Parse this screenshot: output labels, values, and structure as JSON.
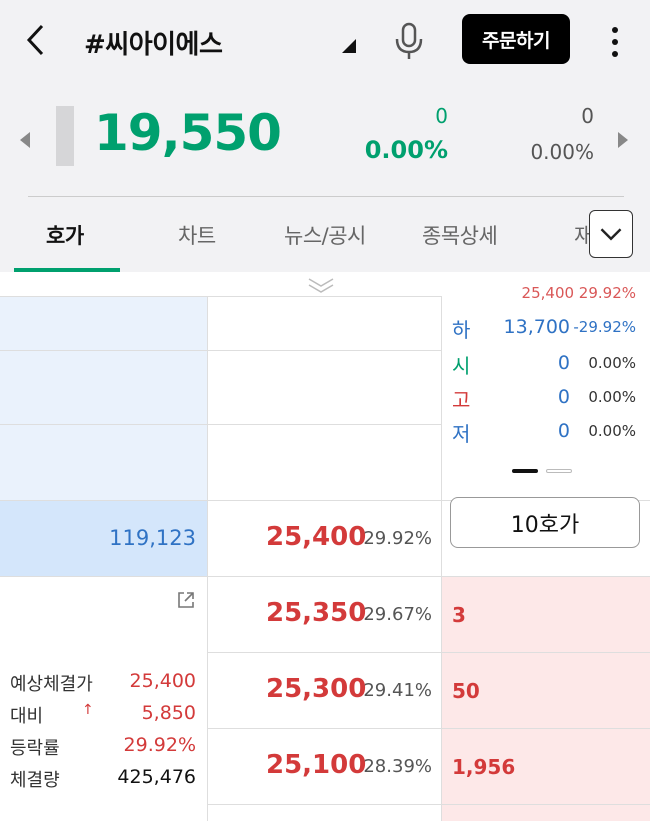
{
  "header": {
    "title": "#씨아이에스",
    "order_label": "주문하기"
  },
  "quote": {
    "price": "19,550",
    "change": "0",
    "change_rate": "0.00%",
    "market_change": "0",
    "market_rate": "0.00%"
  },
  "tabs": [
    {
      "label": "호가"
    },
    {
      "label": "차트"
    },
    {
      "label": "뉴스/공시"
    },
    {
      "label": "종목상세"
    },
    {
      "label": "재"
    }
  ],
  "info": {
    "partial_top": "25,400 29.92%",
    "rows": [
      {
        "label": "하",
        "value": "13,700",
        "pct": "-29.92%"
      },
      {
        "label": "시",
        "value": "0",
        "pct": "0.00%"
      },
      {
        "label": "고",
        "value": "0",
        "pct": "0.00%"
      },
      {
        "label": "저",
        "value": "0",
        "pct": "0.00%"
      }
    ]
  },
  "ten_button": "10호가",
  "orderbook": {
    "ask_total": "119,123",
    "levels": [
      {
        "price": "25,400",
        "pct": "29.92%",
        "bid": ""
      },
      {
        "price": "25,350",
        "pct": "29.67%",
        "bid": "3"
      },
      {
        "price": "25,300",
        "pct": "29.41%",
        "bid": "50"
      },
      {
        "price": "25,100",
        "pct": "28.39%",
        "bid": "1,956"
      }
    ]
  },
  "summary": [
    {
      "label": "예상체결가",
      "value": "25,400"
    },
    {
      "label": "대비",
      "value": "5,850",
      "arrow": "↑"
    },
    {
      "label": "등락률",
      "value": "29.92%"
    },
    {
      "label": "체결량",
      "value": "425,476"
    }
  ],
  "colors": {
    "up": "#d33a3a",
    "down": "#2f72c4",
    "neutral": "#00a06e"
  }
}
